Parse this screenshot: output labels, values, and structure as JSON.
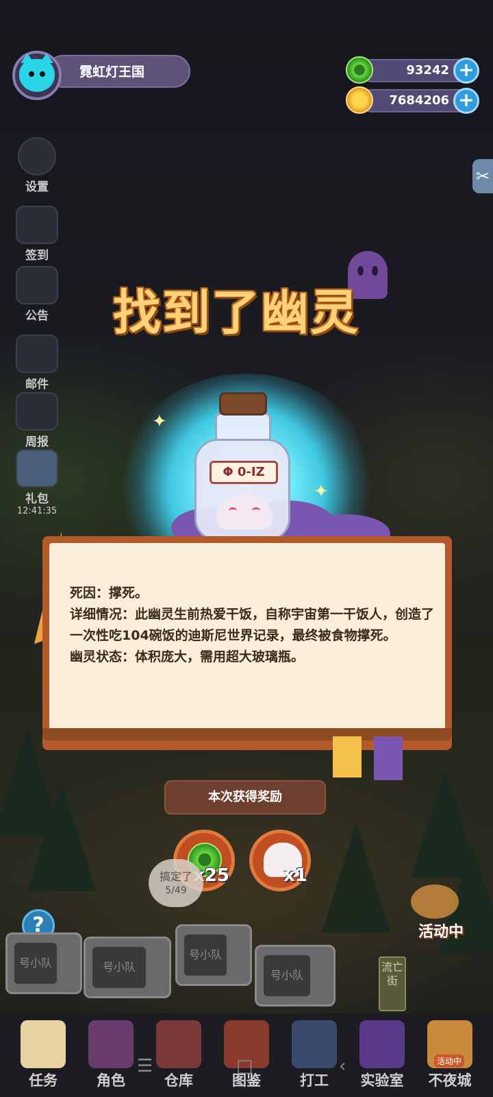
{
  "profile": {
    "name": "霓虹灯王国"
  },
  "currency": [
    {
      "name": "green-coin",
      "value": "93242",
      "color": "#4fbf3a"
    },
    {
      "name": "gold-coin",
      "value": "7684206",
      "color": "#f0a52a"
    }
  ],
  "side_menu": [
    {
      "label": "设置",
      "icon": "gear-icon"
    },
    {
      "label": "签到",
      "icon": "checkin-icon"
    },
    {
      "label": "公告",
      "icon": "megaphone-icon"
    },
    {
      "label": "邮件",
      "icon": "mail-icon"
    },
    {
      "label": "周报",
      "icon": "newspaper-icon"
    },
    {
      "label": "礼包",
      "icon": "gift-icon",
      "timer": "12:41:35"
    }
  ],
  "title": "找到了幽灵",
  "bottle": {
    "tag": "Φ 0-IZ"
  },
  "description": {
    "line1": "死因：撑死。",
    "line2": "详细情况：此幽灵生前热爱干饭，自称宇宙第一干饭人，创造了一次性吃104碗饭的迪斯尼世界记录，最终被食物撑死。",
    "line3": "幽灵状态：体积庞大，需用超大玻璃瓶。"
  },
  "rewards": {
    "banner": "本次获得奖励",
    "items": [
      {
        "icon": "green-coin-icon",
        "qty": "x25"
      },
      {
        "icon": "ghost-icon",
        "qty": "x1"
      }
    ]
  },
  "npc_bubble": {
    "text": "搞定了",
    "progress": "5/49"
  },
  "help": "?",
  "teams": [
    "号小队",
    "号小队",
    "号小队",
    "号小队"
  ],
  "side_street": "流亡街",
  "event": "活动中",
  "nav": [
    {
      "label": "任务",
      "icon": "task-icon"
    },
    {
      "label": "角色",
      "icon": "character-icon"
    },
    {
      "label": "仓库",
      "icon": "warehouse-icon"
    },
    {
      "label": "图鉴",
      "icon": "codex-icon"
    },
    {
      "label": "打工",
      "icon": "work-icon"
    },
    {
      "label": "实验室",
      "icon": "lab-icon"
    },
    {
      "label": "不夜城",
      "icon": "city-icon",
      "badge": "活动中"
    }
  ],
  "colors": {
    "accent_title": "#ffd27a",
    "book_border": "#b45a2a",
    "page": "#faeeda",
    "reward_bg": "#bf4e22"
  }
}
